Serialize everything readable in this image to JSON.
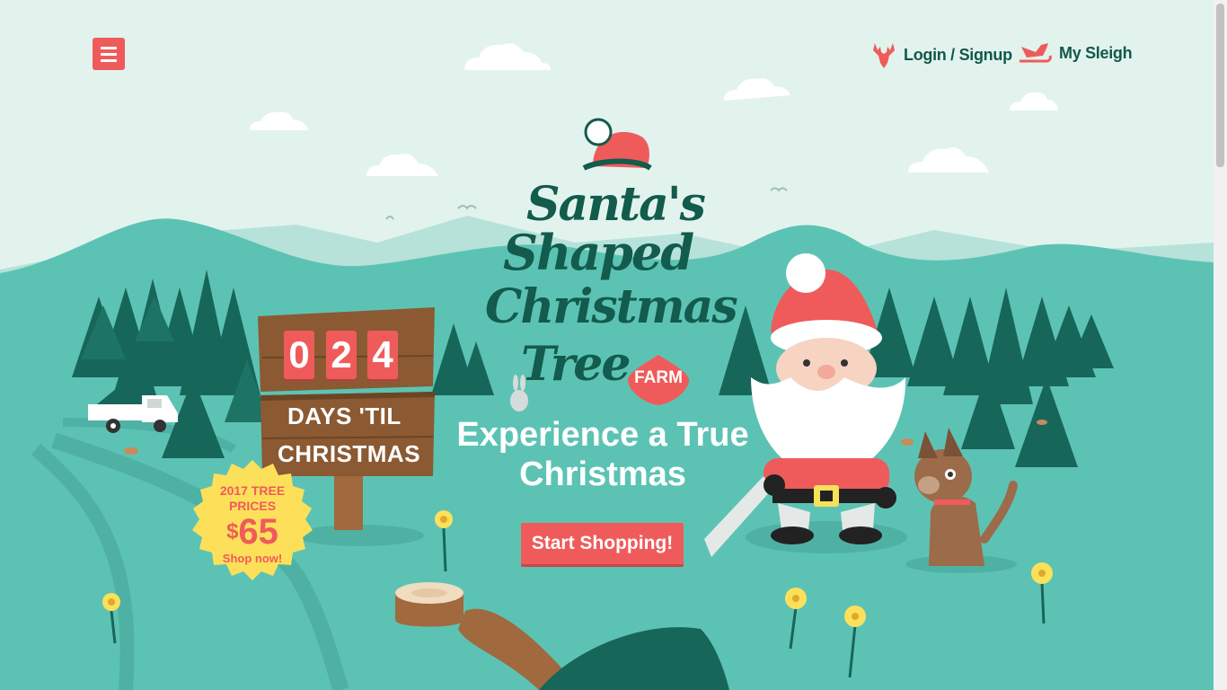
{
  "nav": {
    "login_label": "Login / Signup",
    "sleigh_label": "My Sleigh"
  },
  "logo": {
    "line1": "Santa's",
    "line2": "Shaped",
    "line3": "Christmas",
    "line4": "Tree",
    "badge": "FARM"
  },
  "hero": {
    "headline_line1": "Experience a True",
    "headline_line2": "Christmas",
    "cta_label": "Start Shopping!"
  },
  "countdown": {
    "digits": [
      "0",
      "2",
      "4"
    ],
    "line1": "DAYS 'TIL",
    "line2": "CHRISTMAS"
  },
  "price_badge": {
    "line1": "2017 TREE",
    "line2": "PRICES",
    "currency": "$",
    "price": "65",
    "action": "Shop now!"
  },
  "colors": {
    "accent": "#ef5b5b",
    "brand_dark": "#125b4d",
    "ground": "#5cc3b4",
    "sky": "#e2f3ee",
    "badge_yellow": "#fde05a"
  },
  "icons": {
    "menu": "hamburger-icon",
    "login": "reindeer-icon",
    "sleigh": "sleigh-icon"
  }
}
